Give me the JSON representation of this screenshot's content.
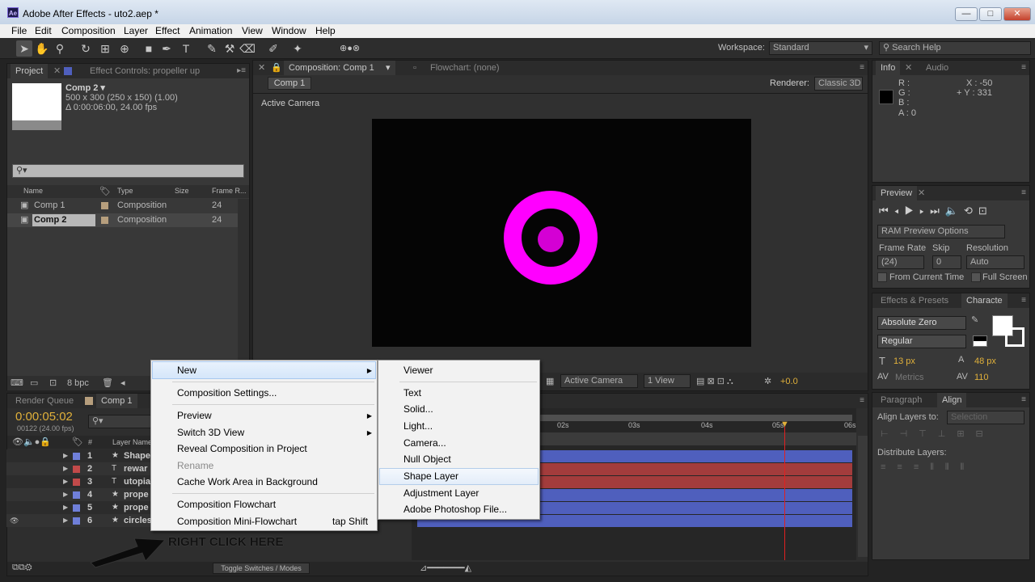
{
  "window": {
    "title": "Adobe After Effects - uto2.aep *",
    "app_icon": "Ae",
    "min": "—",
    "max": "□",
    "close": "✕"
  },
  "menu": [
    "File",
    "Edit",
    "Composition",
    "Layer",
    "Effect",
    "Animation",
    "View",
    "Window",
    "Help"
  ],
  "toolbar": {
    "workspace_label": "Workspace:",
    "workspace_value": "Standard",
    "search_placeholder": "Search Help"
  },
  "project_panel": {
    "tabs": [
      "Project",
      "Effect Controls: propeller up"
    ],
    "selected_name": "Comp 2 ▾",
    "selected_info": [
      "500 x 300  (250 x 150) (1.00)",
      "Δ 0:00:06:00, 24.00 fps"
    ],
    "columns": [
      "Name",
      "Type",
      "Size",
      "Frame R..."
    ],
    "items": [
      {
        "name": "Comp 1",
        "type": "Composition",
        "fps": "24"
      },
      {
        "name": "Comp 2",
        "type": "Composition",
        "fps": "24"
      }
    ],
    "bpc": "8 bpc"
  },
  "comp_panel": {
    "tab": "Composition: Comp 1",
    "flowchart": "Flowchart: (none)",
    "subtab": "Comp 1",
    "renderer_label": "Renderer:",
    "renderer_value": "Classic 3D",
    "camera_label": "Active Camera",
    "bg_color": "#050505",
    "ring_color": "#ff00ff",
    "camera_select": "Active Camera",
    "view_select": "1 View",
    "exposure": "+0.0"
  },
  "info_panel": {
    "tabs": [
      "Info",
      "Audio"
    ],
    "rgba": [
      "R :",
      "G :",
      "B :",
      "A : 0"
    ],
    "x": "X : -50",
    "y": "+ Y : 331"
  },
  "preview_panel": {
    "tab": "Preview",
    "ram_options": "RAM Preview Options",
    "frame_rate_label": "Frame Rate",
    "skip_label": "Skip",
    "resolution_label": "Resolution",
    "frame_rate_value": "(24)",
    "skip_value": "0",
    "resolution_value": "Auto",
    "from_current": "From Current Time",
    "full_screen": "Full Screen"
  },
  "character_panel": {
    "tabs": [
      "Effects & Presets",
      "Characte"
    ],
    "font": "Absolute Zero",
    "style": "Regular",
    "size": "13 px",
    "leading": "48 px",
    "kerning": "Metrics",
    "tracking": "110"
  },
  "align_panel": {
    "tabs": [
      "Paragraph",
      "Align"
    ],
    "align_to_label": "Align Layers to:",
    "align_to_value": "Selection",
    "distribute_label": "Distribute Layers:"
  },
  "timeline": {
    "tabs": [
      "Render Queue",
      "Comp 1"
    ],
    "timecode": "0:00:05:02",
    "frame_info": "00122 (24.00 fps)",
    "layer_name_header": "Layer Name",
    "num_header": "#",
    "layers": [
      {
        "num": "1",
        "name": "Shape",
        "color": "#6f7fd9",
        "star": "★"
      },
      {
        "num": "2",
        "name": "rewar",
        "color": "#c24a4a",
        "star": "T"
      },
      {
        "num": "3",
        "name": "utopia",
        "color": "#c24a4a",
        "star": "T"
      },
      {
        "num": "4",
        "name": "prope",
        "color": "#6f7fd9",
        "star": "★"
      },
      {
        "num": "5",
        "name": "prope",
        "color": "#6f7fd9",
        "star": "★"
      },
      {
        "num": "6",
        "name": "circles",
        "color": "#6f7fd9",
        "star": "★"
      }
    ],
    "ruler": [
      "02s",
      "03s",
      "04s",
      "05s",
      "06s"
    ],
    "toggle": "Toggle Switches / Modes",
    "annotation": "RIGHT CLICK HERE"
  },
  "context_menu": {
    "items": [
      {
        "label": "New",
        "submenu": true
      },
      {
        "label": "Composition Settings..."
      },
      {
        "label": "Preview",
        "submenu": true
      },
      {
        "label": "Switch 3D View",
        "submenu": true
      },
      {
        "label": "Reveal Composition in Project"
      },
      {
        "label": "Rename",
        "disabled": true
      },
      {
        "label": "Cache Work Area in Background"
      },
      {
        "label": "Composition Flowchart"
      },
      {
        "label": "Composition Mini-Flowchart",
        "shortcut": "tap Shift"
      }
    ]
  },
  "submenu": {
    "items": [
      "Viewer",
      "Text",
      "Solid...",
      "Light...",
      "Camera...",
      "Null Object",
      "Shape Layer",
      "Adjustment Layer",
      "Adobe Photoshop File..."
    ]
  }
}
